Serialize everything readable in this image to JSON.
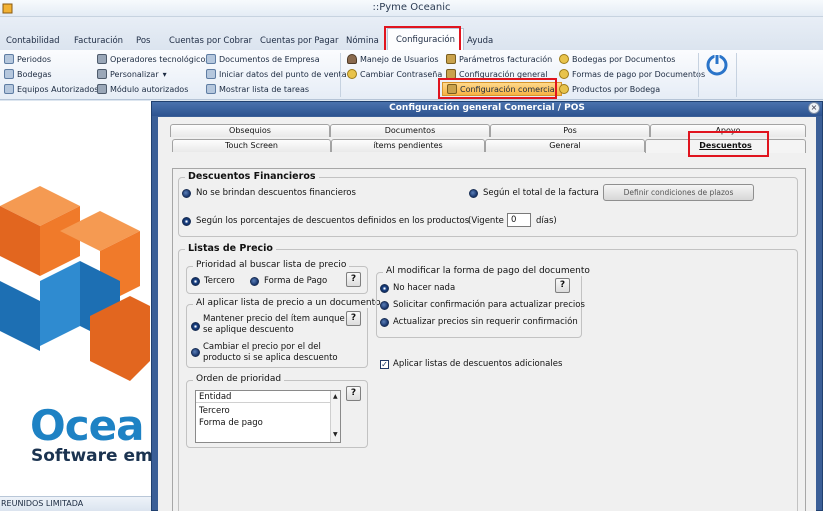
{
  "window": {
    "title": "::Pyme Oceanic"
  },
  "menu": {
    "tabs": [
      {
        "label": "Contabilidad"
      },
      {
        "label": "Facturación"
      },
      {
        "label": "Pos"
      },
      {
        "label": "Cuentas por Cobrar"
      },
      {
        "label": "Cuentas por Pagar"
      },
      {
        "label": "Nómina"
      },
      {
        "label": "Configuración"
      },
      {
        "label": "Ayuda"
      }
    ],
    "active": "Configuración"
  },
  "ribbon": {
    "col1": [
      "Periodos",
      "Bodegas",
      "Equipos Autorizados"
    ],
    "col2": [
      "Operadores tecnológicos",
      "Personalizar",
      "Módulo autorizados"
    ],
    "col3": [
      "Documentos de Empresa",
      "Iniciar datos del punto de venta",
      "Mostrar lista de tareas"
    ],
    "col4": [
      "Manejo de Usuarios",
      "Cambiar Contraseña"
    ],
    "col5": [
      "Parámetros facturación",
      "Configuración general",
      "Configuración comercial"
    ],
    "col6": [
      "Bodegas por Documentos",
      "Formas de pago por Documentos",
      "Productos por Bodega"
    ],
    "dropdown_glyph": "▾"
  },
  "background": {
    "brand_main": "Ocea",
    "brand_sub": "Software em",
    "status_text": "REUNIDOS LIMITADA"
  },
  "dialog": {
    "title": "Configuración general Comercial / POS",
    "close_glyph": "×",
    "tabs_back": [
      "Obsequios",
      "Documentos",
      "Pos",
      "Apoyo"
    ],
    "tabs_front": [
      "Touch Screen",
      "ítems pendientes",
      "General",
      "Descuentos"
    ],
    "selected_tab": "Descuentos",
    "descuentos_financieros": {
      "legend": "Descuentos Financieros",
      "opt_none": "No se brindan descuentos financieros",
      "opt_total": "Según el total de la factura",
      "define_button": "Definir condiciones de plazos",
      "opt_products": "Según los porcentajes de descuentos definidos en los productos",
      "vigencia_label": "(Vigente",
      "vigencia_value": "0",
      "dias_label": "días)"
    },
    "listas_precio": {
      "legend": "Listas de Precio",
      "prioridad": {
        "legend": "Prioridad al buscar lista de precio",
        "opt_tercero": "Tercero",
        "opt_forma_pago": "Forma de Pago"
      },
      "aplicar": {
        "legend": "Al aplicar lista de precio a un documento",
        "opt_mantener": [
          "Mantener precio del ítem aunque",
          "se aplique descuento"
        ],
        "opt_cambiar": [
          "Cambiar el precio por el del",
          "producto si se aplica descuento"
        ]
      },
      "orden": {
        "legend": "Orden de prioridad",
        "header": "Entidad",
        "items": [
          "Tercero",
          "Forma de pago"
        ]
      },
      "modificar": {
        "legend": "Al modificar la forma de pago del documento",
        "opt_nada": "No hacer nada",
        "opt_solicitar": "Solicitar confirmación para actualizar precios",
        "opt_actualizar": "Actualizar precios sin requerir confirmación"
      },
      "aplicar_adicionales": "Aplicar listas de descuentos adicionales",
      "help_glyph": "?",
      "check_glyph": "✓",
      "arrow_up": "▲",
      "arrow_down": "▼"
    }
  },
  "colors": {
    "highlight_red": "#e0141e",
    "dialog_blue": "#3b5f97",
    "brand_blue": "#1e82c4",
    "brand_orange": "#f07a2a"
  }
}
